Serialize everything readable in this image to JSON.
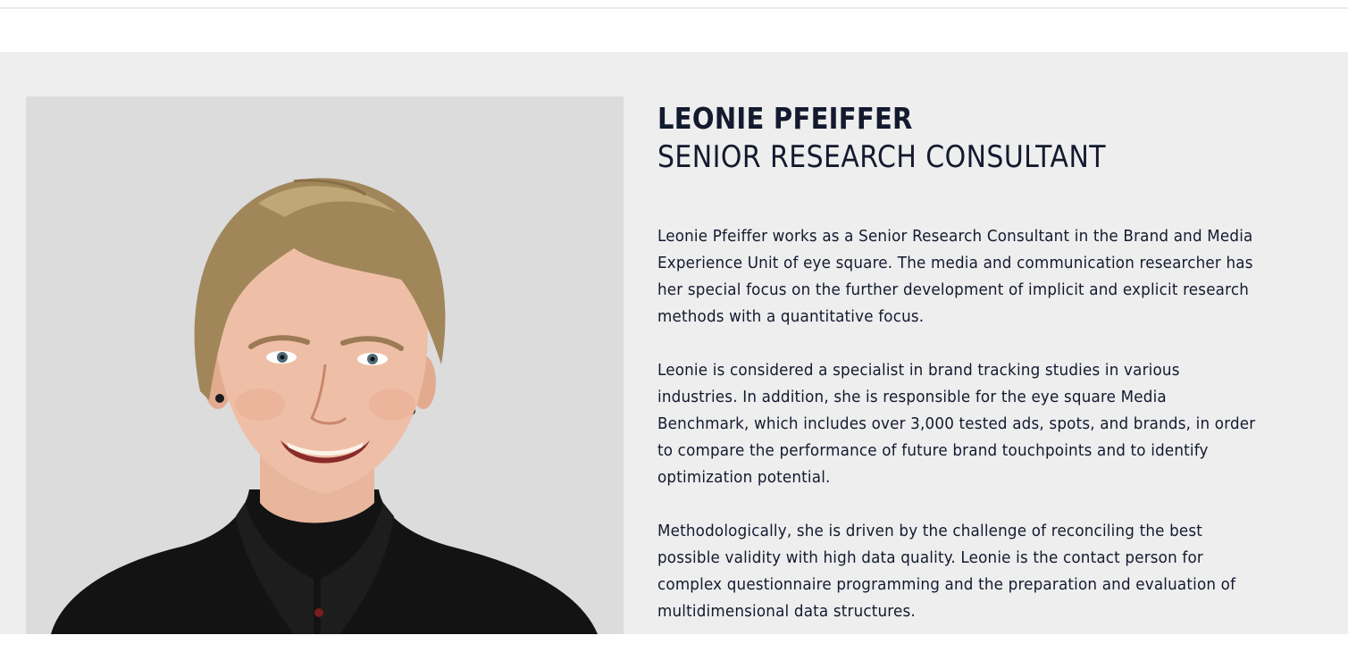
{
  "profile": {
    "name": "LEONIE PFEIFFER",
    "role": "SENIOR RESEARCH CONSULTANT",
    "photo_icon": "portrait-photo",
    "bio": [
      "Leonie Pfeiffer works as a Senior Research Consultant in the Brand and Media Experience Unit of eye square. The media and communication researcher has her special focus on the further development of implicit and explicit research methods with a quantitative focus.",
      "Leonie is considered a specialist in brand tracking studies in various industries. In addition, she is responsible for the eye square Media Benchmark, which includes over 3,000 tested ads, spots, and brands, in order to compare the performance of future brand touchpoints and to identify optimization potential.",
      "Methodologically, she is driven by the challenge of reconciling the best possible validity with high data quality. Leonie is the contact person for complex questionnaire programming and the preparation and evaluation of multidimensional data structures."
    ]
  },
  "colors": {
    "section_bg": "#eeeeef",
    "photo_bg": "#dcdcdd",
    "text": "#141a2e"
  }
}
